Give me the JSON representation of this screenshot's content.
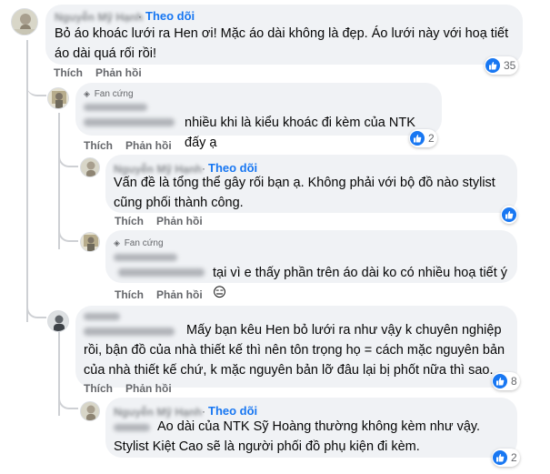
{
  "comments": [
    {
      "follow": "Theo dõi",
      "author_badge": "",
      "text": "Bỏ áo khoác lưới ra Hen ơi! Mặc áo dài không là đẹp. Áo lưới này với hoạ tiết áo dài quá rối rồi!",
      "actions": {
        "like": "Thích",
        "reply": "Phản hồi"
      },
      "reaction_count": "35"
    },
    {
      "follow": "",
      "author_badge": "Fan cứng",
      "text": "nhiều khi là kiểu khoác đi kèm của NTK đấy ạ",
      "actions": {
        "like": "Thích",
        "reply": "Phản hồi"
      },
      "reaction_count": "2"
    },
    {
      "follow": "Theo dõi",
      "author_badge": "",
      "text": "Vấn đề là tổng thể gây rối bạn ạ. Không phải với bộ đồ nào stylist cũng phối thành công.",
      "actions": {
        "like": "Thích",
        "reply": "Phản hồi"
      },
      "reaction_count": ""
    },
    {
      "follow": "",
      "author_badge": "Fan cứng",
      "text": "tại vì e thấy phần trên áo dài ko có nhiều hoạ tiết ý 😑",
      "actions": {
        "like": "Thích",
        "reply": "Phản hồi"
      },
      "reaction_count": ""
    },
    {
      "follow": "",
      "author_badge": "",
      "text": "Mấy bạn kêu Hen bỏ lưới ra như vậy k chuyên nghiệp rồi, bận đồ của nhà thiết kế thì nên tôn trọng họ = cách mặc nguyên bản của nhà thiết kế chứ, k mặc nguyên bản lỡ đâu lại bị phốt nữa thì sao.",
      "actions": {
        "like": "Thích",
        "reply": "Phản hồi"
      },
      "reaction_count": "8"
    },
    {
      "follow": "Theo dõi",
      "author_badge": "",
      "text": "Ao dài của NTK Sỹ Hoàng thường không kèm như vậy. Stylist Kiệt Cao sẽ là người phối đồ phụ kiện đi kèm.",
      "actions": {
        "like": "Thích",
        "reply": "Phản hồi"
      },
      "reaction_count": "2"
    }
  ],
  "separator": "·",
  "colors": {
    "accent": "#1877f2",
    "bubble": "#f0f2f5",
    "muted": "#65676b"
  },
  "icons": {
    "reaction": "like-thumb-icon",
    "badge": "diamond-icon"
  }
}
